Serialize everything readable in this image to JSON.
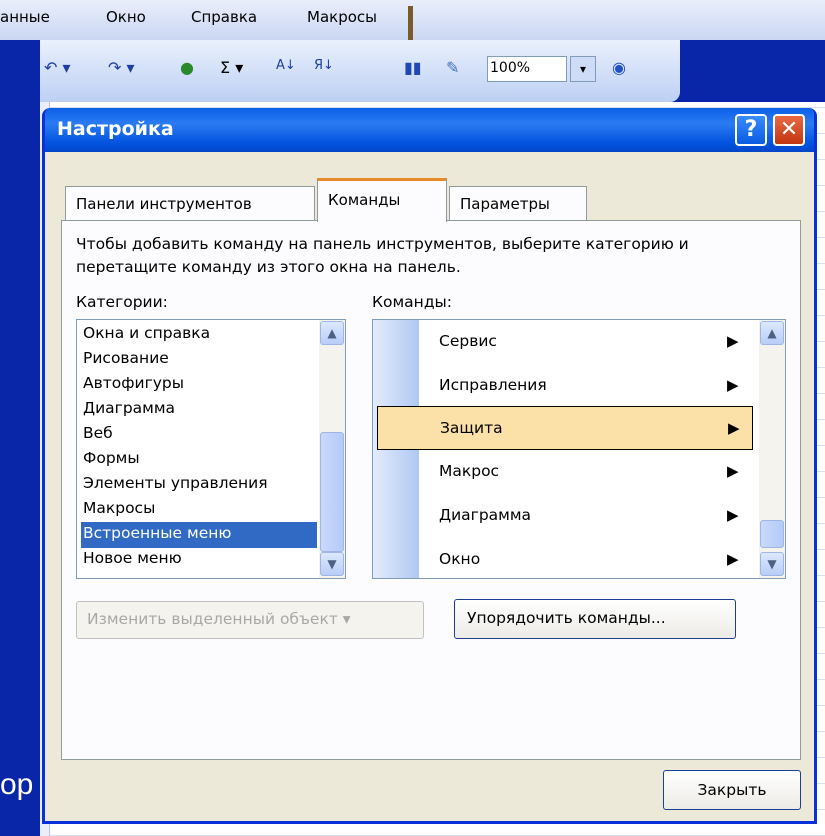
{
  "menubar": {
    "items": [
      "анные",
      "Окно",
      "Справка",
      "Макросы"
    ]
  },
  "toolbar": {
    "undo": "↶ ▾",
    "redo": "↷ ▾",
    "sigma": "Σ ▾",
    "zoom": "100%",
    "icons": [
      "undo-icon",
      "redo-icon",
      "hyperlink-icon",
      "autosum-icon",
      "sort-ascending-icon",
      "sort-descending-icon",
      "chart-wizard-icon",
      "drawing-icon",
      "help-icon"
    ]
  },
  "background": {
    "footer_text": "ор"
  },
  "dialog": {
    "title": "Настройка",
    "help_button": "?",
    "close_x": "✕",
    "tabs": [
      "Панели инструментов",
      "Команды",
      "Параметры"
    ],
    "active_tab": "Команды",
    "instruction": "Чтобы добавить команду на панель инструментов, выберите категорию и перетащите команду из этого окна на панель.",
    "categories_label": "Категории:",
    "commands_label": "Команды:",
    "categories": [
      "Окна и справка",
      "Рисование",
      "Автофигуры",
      "Диаграмма",
      "Веб",
      "Формы",
      "Элементы управления",
      "Макросы",
      "Встроенные меню",
      "Новое меню"
    ],
    "selected_category": "Встроенные меню",
    "commands": [
      "Сервис",
      "Исправления",
      "Защита",
      "Макрос",
      "Диаграмма",
      "Окно"
    ],
    "selected_command": "Защита",
    "modify_button": "Изменить выделенный объект ▾",
    "rearrange_button": "Упорядочить команды...",
    "close_button": "Закрыть"
  }
}
